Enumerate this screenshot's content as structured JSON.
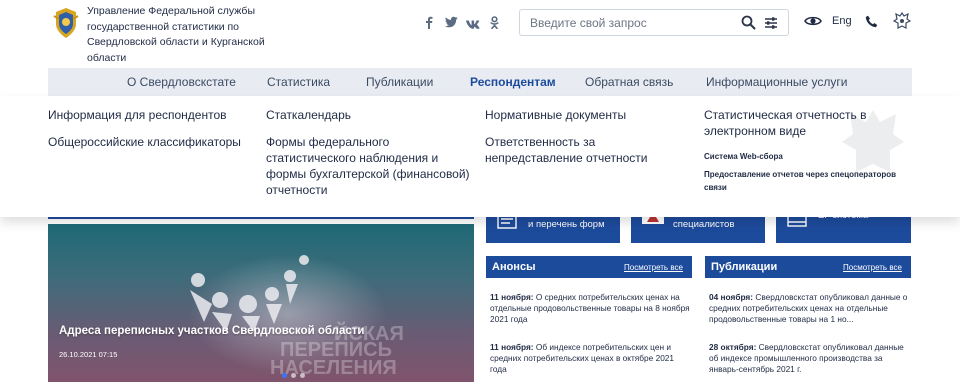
{
  "header": {
    "org_name": "Управление Федеральной службы государственной статистики по Свердловской области и Курганской области",
    "search_placeholder": "Введите свой запрос",
    "lang_label": "Eng"
  },
  "nav": {
    "items": [
      {
        "label": "О Свердловскстате"
      },
      {
        "label": "Статистика"
      },
      {
        "label": "Публикации"
      },
      {
        "label": "Респондентам"
      },
      {
        "label": "Обратная связь"
      },
      {
        "label": "Информационные услуги"
      }
    ]
  },
  "dropdown": {
    "col1": [
      "Информация для респондентов",
      "Общероссийские классификаторы"
    ],
    "col2": [
      "Статкалендарь",
      "Формы федерального статистического наблюдения и формы бухгалтерской (финансовой) отчетности"
    ],
    "col3": [
      "Нормативные документы",
      "Ответственность за непредставление отчетности"
    ],
    "col4_main": "Статистическая отчетность в электронном виде",
    "col4_sub": [
      "Система Web-сбора",
      "Предоставление отчетов через спецоператоров связи"
    ]
  },
  "tiles": [
    {
      "label": "и перечень форм"
    },
    {
      "label": "специалистов"
    },
    {
      "label": "ЕГ система"
    }
  ],
  "banner": {
    "title": "Адреса переписных участков Свердловской области",
    "date": "26.10.2021 07:15",
    "bg_text_1": "ЙСКАЯ",
    "bg_text_2": "ПЕРЕПИСЬ",
    "bg_text_3": "НАСЕЛЕНИЯ"
  },
  "announcements": {
    "title": "Анонсы",
    "see_all": "Посмотреть все",
    "items": [
      {
        "date": "11 ноября:",
        "text": " О средних потребительских ценах на отдельные продовольственные товары на 8 ноября 2021 года"
      },
      {
        "date": "11 ноября:",
        "text": " Об индексе потребительских цен и средних потребительских ценах в октябре 2021 года"
      }
    ]
  },
  "publications": {
    "title": "Публикации",
    "see_all": "Посмотреть все",
    "items": [
      {
        "date": "04 ноября:",
        "text": " Свердловскстат опубликовал данные о средних потребительских ценах на отдельные продовольственные товары на 1 но..."
      },
      {
        "date": "28 октября:",
        "text": " Свердловскстат опубликовал данные об индексе промышленного производства за январь-сентябрь 2021 г."
      }
    ]
  },
  "colors": {
    "accent": "#1d4b9c",
    "nav_bg": "#e8ecf2",
    "text": "#1f2a44"
  }
}
